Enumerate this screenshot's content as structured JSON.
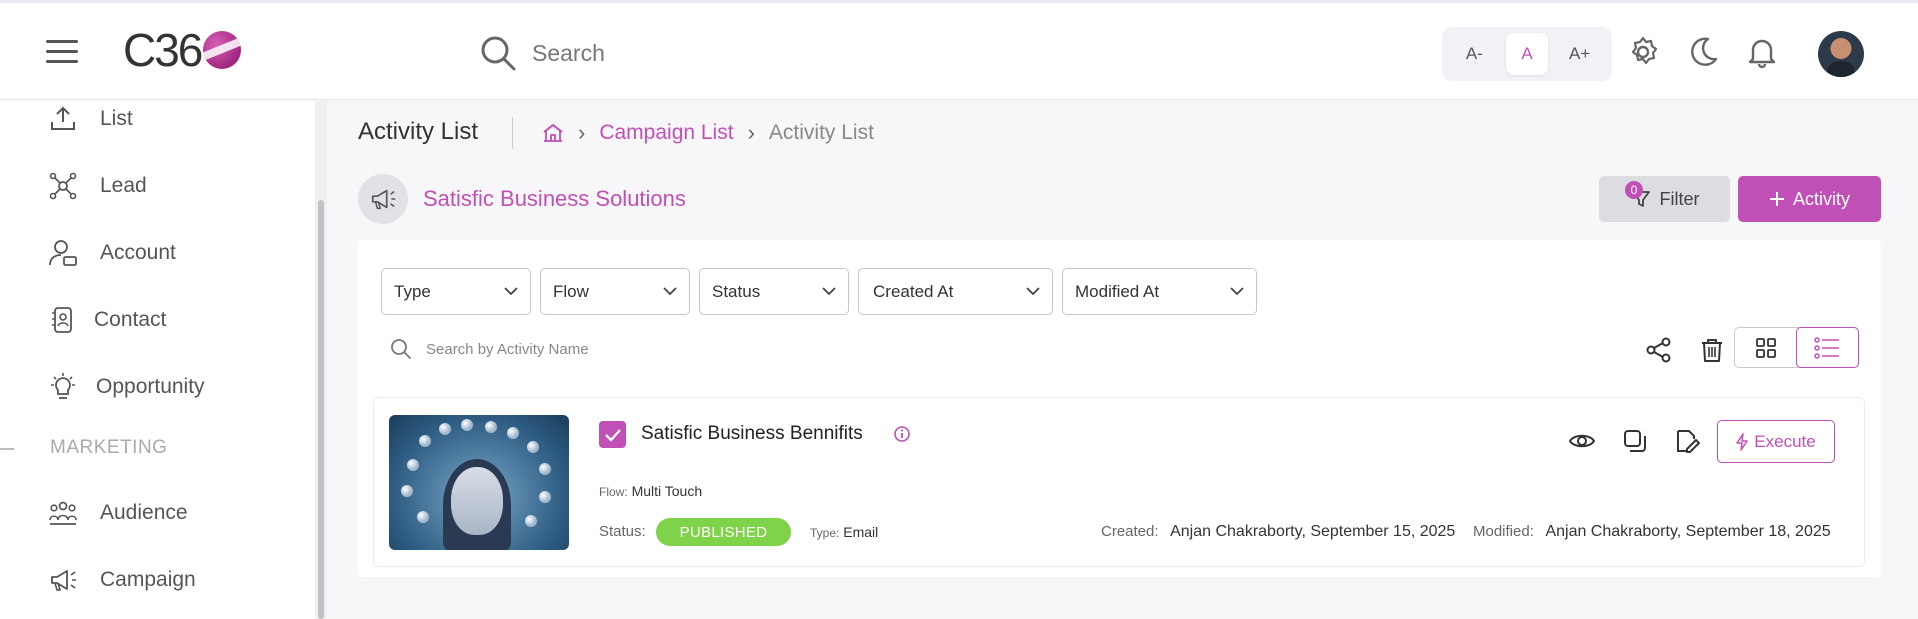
{
  "header": {
    "logo_text": "C36",
    "search_placeholder": "Search",
    "font_sizes": [
      "A-",
      "A",
      "A+"
    ],
    "accent": "#c04fb6"
  },
  "sidebar": {
    "items": [
      {
        "label": "List",
        "icon": "upload-icon"
      },
      {
        "label": "Lead",
        "icon": "network-icon"
      },
      {
        "label": "Account",
        "icon": "account-icon"
      },
      {
        "label": "Contact",
        "icon": "contact-icon"
      },
      {
        "label": "Opportunity",
        "icon": "lightbulb-icon"
      },
      {
        "label": "Audience",
        "icon": "audience-icon"
      },
      {
        "label": "Campaign",
        "icon": "megaphone-icon"
      }
    ],
    "section_marketing": "MARKETING"
  },
  "page": {
    "title": "Activity List",
    "breadcrumb": {
      "campaign_list": "Campaign List",
      "current": "Activity List"
    },
    "campaign_name": "Satisfic Business Solutions",
    "filter_label": "Filter",
    "filter_count": "0",
    "add_activity_label": "Activity"
  },
  "filters": {
    "type": "Type",
    "flow": "Flow",
    "status": "Status",
    "created_at": "Created At",
    "modified_at": "Modified At",
    "search_placeholder": "Search by Activity Name"
  },
  "activity": {
    "title": "Satisfic Business Bennifits",
    "flow_label": "Flow:",
    "flow_value": "Multi Touch",
    "status_label": "Status:",
    "status_value": "PUBLISHED",
    "type_label": "Type:",
    "type_value": "Email",
    "created_label": "Created:",
    "created_value": "Anjan Chakraborty, September 15, 2025",
    "modified_label": "Modified:",
    "modified_value": "Anjan Chakraborty, September 18, 2025",
    "execute_label": "Execute",
    "status_color": "#7fd34a"
  }
}
